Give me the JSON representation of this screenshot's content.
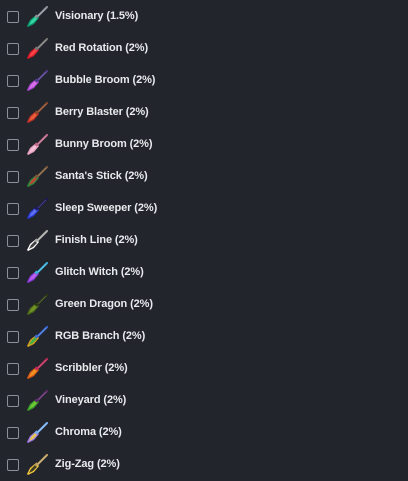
{
  "items": [
    {
      "label": "Visionary (1.5%)",
      "icon": "visionary-broom-icon",
      "colors": [
        "#0a9a6b",
        "#3fe0b0",
        "#8a8f99"
      ]
    },
    {
      "label": "Red Rotation (2%)",
      "icon": "red-rotation-broom-icon",
      "colors": [
        "#d81a2a",
        "#ff4b4b",
        "#777777"
      ]
    },
    {
      "label": "Bubble Broom (2%)",
      "icon": "bubble-broom-icon",
      "colors": [
        "#b04ad8",
        "#e07ae8",
        "#4d3a8a"
      ]
    },
    {
      "label": "Berry Blaster (2%)",
      "icon": "berry-blaster-broom-icon",
      "colors": [
        "#c2302a",
        "#f06a3a",
        "#8a4a2a"
      ]
    },
    {
      "label": "Bunny Broom (2%)",
      "icon": "bunny-broom-icon",
      "colors": [
        "#e8a0c0",
        "#f4c6d8",
        "#c06a8a"
      ]
    },
    {
      "label": "Santa's Stick (2%)",
      "icon": "santas-stick-broom-icon",
      "colors": [
        "#2a8a3a",
        "#d83a3a",
        "#7a5a3a"
      ]
    },
    {
      "label": "Sleep Sweeper (2%)",
      "icon": "sleep-sweeper-broom-icon",
      "colors": [
        "#2a3ad8",
        "#6a7af0",
        "#1a1a5a"
      ]
    },
    {
      "label": "Finish Line (2%)",
      "icon": "finish-line-broom-icon",
      "colors": [
        "#ffffff",
        "#222222",
        "#aaaaaa"
      ]
    },
    {
      "label": "Glitch Witch (2%)",
      "icon": "glitch-witch-broom-icon",
      "colors": [
        "#8a3ad8",
        "#c06af0",
        "#3ab0d8"
      ]
    },
    {
      "label": "Green Dragon (2%)",
      "icon": "green-dragon-broom-icon",
      "colors": [
        "#4a6a1a",
        "#7a9a2a",
        "#2a3a10"
      ]
    },
    {
      "label": "RGB Branch (2%)",
      "icon": "rgb-branch-broom-icon",
      "colors": [
        "#d8a020",
        "#2ab04a",
        "#3a6ad8"
      ]
    },
    {
      "label": "Scribbler (2%)",
      "icon": "scribbler-broom-icon",
      "colors": [
        "#e05a1a",
        "#f0a020",
        "#c02a5a"
      ]
    },
    {
      "label": "Vineyard (2%)",
      "icon": "vineyard-broom-icon",
      "colors": [
        "#3a9a2a",
        "#7ad03a",
        "#5a2a6a"
      ]
    },
    {
      "label": "Chroma (2%)",
      "icon": "chroma-broom-icon",
      "colors": [
        "#a07ae8",
        "#f0d83a",
        "#7ab0f0"
      ]
    },
    {
      "label": "Zig-Zag (2%)",
      "icon": "zig-zag-broom-icon",
      "colors": [
        "#f0c83a",
        "#222222",
        "#c0a060"
      ]
    }
  ]
}
